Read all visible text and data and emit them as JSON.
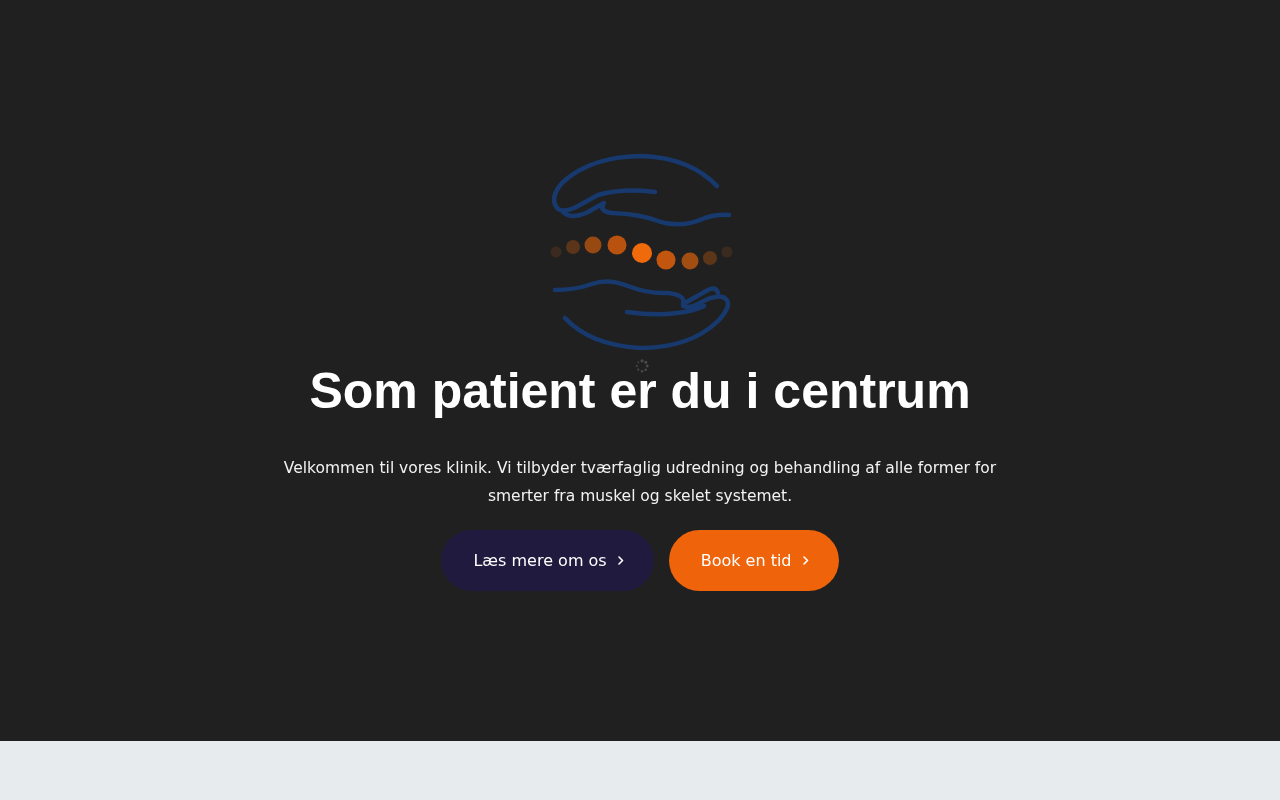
{
  "hero": {
    "loading": true,
    "heading": "Som patient er du i centrum",
    "text": "Velkommen til vores klinik. Vi tilbyder tværfaglig udredning og behandling af alle former for smerter fra muskel og skelet systemet.",
    "buttons": [
      {
        "label": "Læs mere om os",
        "kind": "secondary"
      },
      {
        "label": "Book en tid",
        "kind": "primary"
      }
    ]
  }
}
